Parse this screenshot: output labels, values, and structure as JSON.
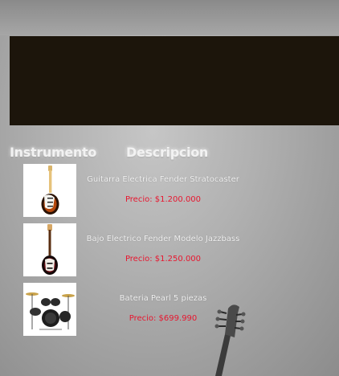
{
  "headers": {
    "instrument": "Instrumento",
    "description": "Descripcion"
  },
  "products": [
    {
      "name": "Guitarra Electrica Fender Stratocaster",
      "price": "Precio: $1.200.000",
      "icon": "electric-guitar-icon"
    },
    {
      "name": "Bajo Electrico Fender Modelo Jazzbass",
      "price": "Precio: $1.250.000",
      "icon": "bass-guitar-icon"
    },
    {
      "name": "Bateria Pearl 5 piezas",
      "price": "Precio: $699.990",
      "icon": "drum-kit-icon"
    }
  ],
  "colors": {
    "banner": "#1c150b",
    "price": "#e8162f",
    "text": "#f4f4f4"
  }
}
